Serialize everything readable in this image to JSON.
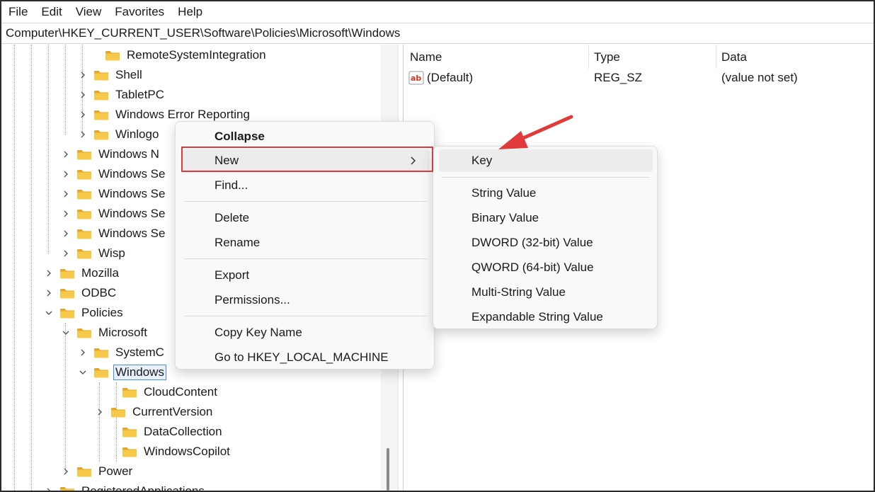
{
  "menubar": {
    "items": [
      "File",
      "Edit",
      "View",
      "Favorites",
      "Help"
    ]
  },
  "address": "Computer\\HKEY_CURRENT_USER\\Software\\Policies\\Microsoft\\Windows",
  "tree": {
    "items": [
      "RemoteSystemIntegration",
      "Shell",
      "TabletPC",
      "Windows Error Reporting",
      "Winlogo",
      "Windows N",
      "Windows Se",
      "Windows Se",
      "Windows Se",
      "Windows Se",
      "Wisp",
      "Mozilla",
      "ODBC",
      "Policies",
      "Microsoft",
      "SystemC",
      "Windows",
      "CloudContent",
      "CurrentVersion",
      "DataCollection",
      "WindowsCopilot",
      "Power",
      "RegisteredApplications"
    ]
  },
  "list": {
    "headers": {
      "name": "Name",
      "type": "Type",
      "data": "Data"
    },
    "rows": [
      {
        "name": "(Default)",
        "type": "REG_SZ",
        "data": "(value not set)"
      }
    ]
  },
  "context_menu": {
    "items": [
      "Collapse",
      "New",
      "Find...",
      "Delete",
      "Rename",
      "Export",
      "Permissions...",
      "Copy Key Name",
      "Go to HKEY_LOCAL_MACHINE"
    ]
  },
  "submenu": {
    "items": [
      "Key",
      "String Value",
      "Binary Value",
      "DWORD (32-bit) Value",
      "QWORD (64-bit) Value",
      "Multi-String Value",
      "Expandable String Value"
    ]
  },
  "colors": {
    "folder": "#f7c948",
    "folder_dark": "#e0a82e",
    "highlight": "#e23a3a",
    "selection": "#4a90d9"
  },
  "icons": {
    "folder": "folder-icon",
    "expand": "chevron-right-icon",
    "collapse": "chevron-down-icon",
    "string_value": "reg-sz-icon",
    "arrow": "red-arrow-annotation"
  }
}
